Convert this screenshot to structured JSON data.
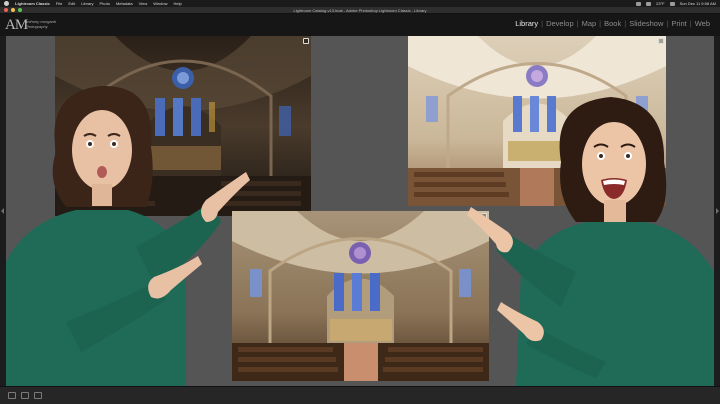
{
  "menubar": {
    "app": "Lightroom Classic",
    "items": [
      "File",
      "Edit",
      "Library",
      "Photo",
      "Metadata",
      "View",
      "Window",
      "Help"
    ],
    "temp": "23°F",
    "clock": "Sun Dec 11  9:58 AM"
  },
  "window": {
    "title": "Lightroom Catalog-v13.lrcat - Adobe Photoshop Lightroom Classic - Library"
  },
  "identity": {
    "monogram": "AM",
    "name_line1": "anthony morganti",
    "name_line2": "Photography"
  },
  "modules": [
    "Library",
    "Develop",
    "Map",
    "Book",
    "Slideshow",
    "Print",
    "Web"
  ],
  "active_module": "Library",
  "colors": {
    "dark": "#161616",
    "grid_bg": "#555555",
    "sweater": "#1f6b57"
  }
}
